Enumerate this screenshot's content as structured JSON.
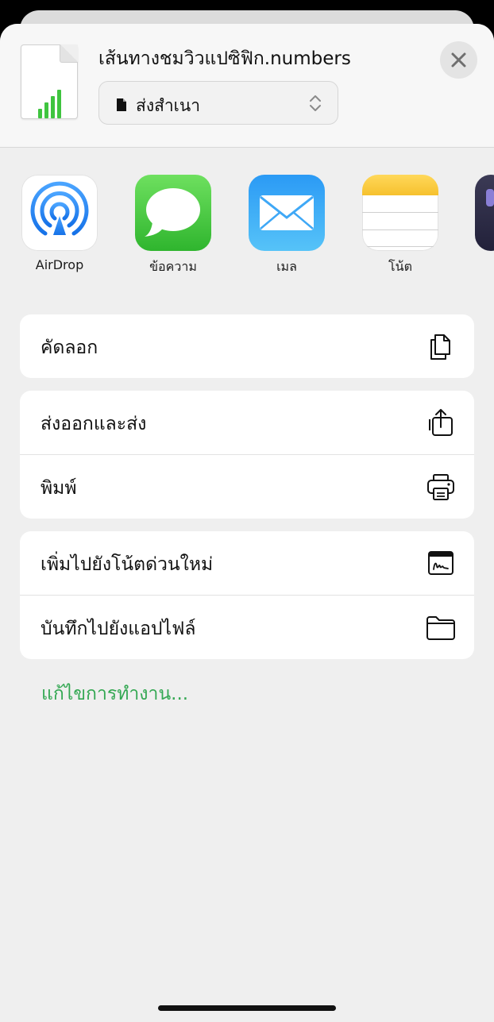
{
  "header": {
    "file_name": "เส้นทางชมวิวแปซิฟิก.numbers",
    "mode": "ส่งสำเนา"
  },
  "apps": [
    {
      "label": "AirDrop",
      "icon": "airdrop-icon"
    },
    {
      "label": "ข้อความ",
      "icon": "messages-icon"
    },
    {
      "label": "เมล",
      "icon": "mail-icon"
    },
    {
      "label": "โน้ต",
      "icon": "notes-icon"
    }
  ],
  "actions": {
    "copy": {
      "label": "คัดลอก",
      "icon": "copy-icon"
    },
    "export": {
      "label": "ส่งออกและส่ง",
      "icon": "share-icon"
    },
    "print": {
      "label": "พิมพ์",
      "icon": "printer-icon"
    },
    "quick_note": {
      "label": "เพิ่มไปยังโน้ตด่วนใหม่",
      "icon": "quick-note-icon"
    },
    "save_files": {
      "label": "บันทึกไปยังแอปไฟล์",
      "icon": "folder-icon"
    }
  },
  "edit_actions": "แก้ไขการทำงาน...",
  "colors": {
    "accent": "#34a853",
    "numbers_green": "#3fc43f",
    "sheet_bg": "#efefef"
  }
}
